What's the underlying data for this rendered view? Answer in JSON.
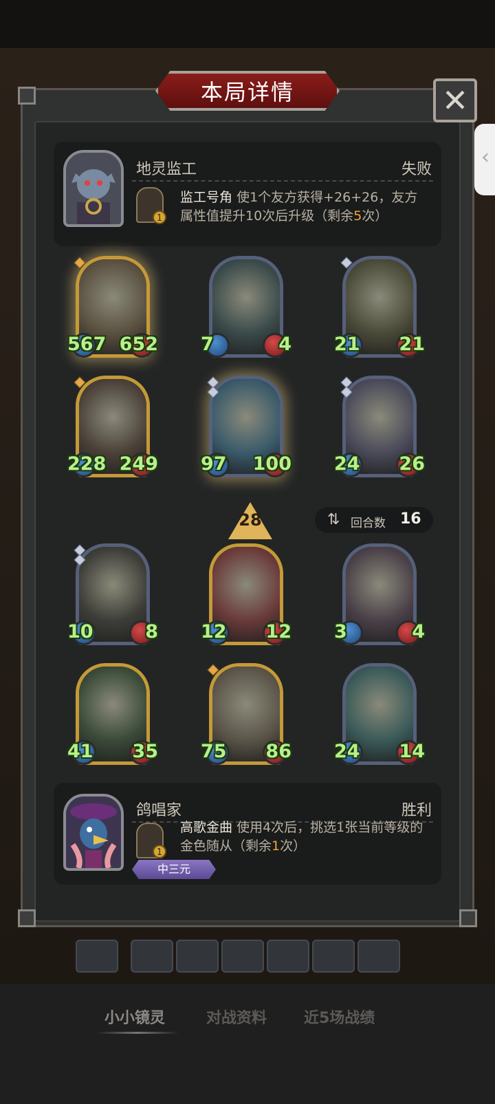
{
  "title": "本局详情",
  "opponent": {
    "name": "地灵监工",
    "result": "失败",
    "power_level": "1",
    "power_name": "监工号角",
    "power_desc_before": "使1个友方获得+26+26，友方属性值提升10次后升级（剩余",
    "power_highlight": "5",
    "power_desc_after": "次）"
  },
  "minions_top": [
    {
      "atk": "567",
      "hp": "652",
      "gold": true,
      "glow": true,
      "gems": 1,
      "gem_gold": true
    },
    {
      "atk": "7",
      "hp": "4",
      "gold": false,
      "glow": false,
      "gems": 0
    },
    {
      "atk": "21",
      "hp": "21",
      "gold": false,
      "glow": false,
      "gems": 1
    },
    {
      "atk": "228",
      "hp": "249",
      "gold": true,
      "glow": false,
      "gems": 1,
      "gem_gold": true
    },
    {
      "atk": "97",
      "hp": "100",
      "gold": false,
      "glow": true,
      "gems": 2
    },
    {
      "atk": "24",
      "hp": "26",
      "gold": false,
      "glow": false,
      "gems": 2
    }
  ],
  "tavern_tier": "28",
  "rounds": {
    "label": "回合数",
    "value": "16"
  },
  "minions_bottom": [
    {
      "atk": "10",
      "hp": "8",
      "gold": false,
      "glow": false,
      "gems": 2
    },
    {
      "atk": "12",
      "hp": "12",
      "gold": true,
      "glow": false,
      "gems": 0
    },
    {
      "atk": "3",
      "hp": "4",
      "gold": false,
      "glow": false,
      "gems": 0
    },
    {
      "atk": "41",
      "hp": "35",
      "gold": true,
      "glow": false,
      "gems": 0
    },
    {
      "atk": "75",
      "hp": "86",
      "gold": true,
      "glow": false,
      "gems": 1,
      "gem_gold": true
    },
    {
      "atk": "24",
      "hp": "14",
      "gold": false,
      "glow": false,
      "gems": 0
    }
  ],
  "player": {
    "name": "鸽唱家",
    "result": "胜利",
    "power_level": "1",
    "power_name": "高歌金曲",
    "power_desc_before": "使用4次后，挑选1张当前等级的金色随从（剩余",
    "power_highlight": "1",
    "power_desc_after": "次）",
    "tier_badge": "中三元"
  },
  "tabs": [
    "小小镜灵",
    "对战资料",
    "近5场战绩"
  ],
  "colors": {
    "stat_text": "#b7f08a",
    "highlight": "#f5a43a",
    "banner": "#8a1d1a"
  }
}
